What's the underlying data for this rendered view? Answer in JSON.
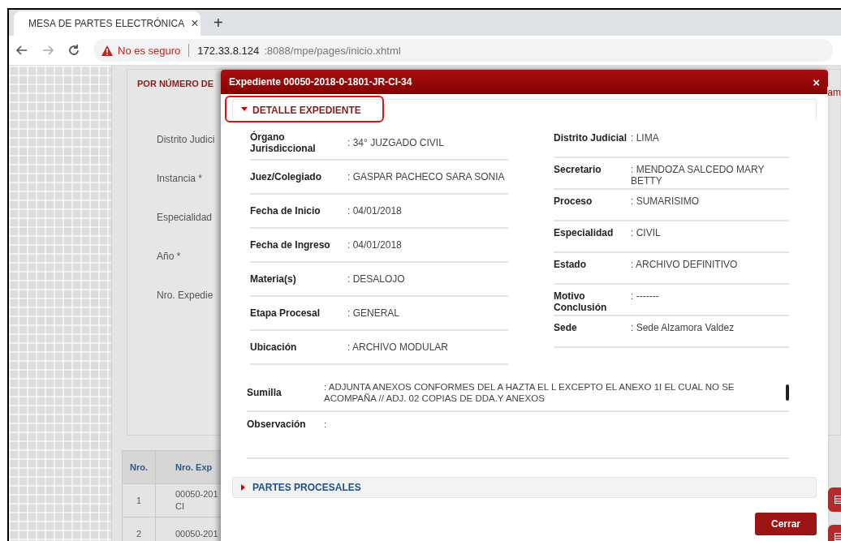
{
  "browser": {
    "tab_title": "MESA DE PARTES ELECTRÓNICA",
    "tab_close": "×",
    "new_tab": "+",
    "warning": "No es seguro",
    "url_host": "172.33.8.124",
    "url_path": ":8088/mpe/pages/inicio.xhtml"
  },
  "page": {
    "tab_label": "POR NÚMERO DE",
    "side_text": "am",
    "form_labels": [
      "Distrito Judici",
      "Instancia *",
      "Especialidad",
      "Año *",
      "Nro. Expedie"
    ],
    "table": {
      "columns": [
        "Nro.",
        "Nro. Exp"
      ],
      "rows": [
        {
          "cells": [
            "1",
            "00050-201\nCI"
          ]
        },
        {
          "cells": [
            "2",
            "00050-201"
          ]
        }
      ]
    }
  },
  "modal": {
    "title": "Expediente 00050-2018-0-1801-JR-CI-34",
    "close": "×",
    "sections": [
      {
        "title": "DETALLE EXPEDIENTE",
        "expanded": true,
        "highlighted": true
      },
      {
        "title": "PARTES PROCESALES",
        "expanded": false,
        "highlighted": false
      }
    ],
    "left_fields": [
      {
        "label": "Órgano Jurisdiccional",
        "value": ": 34° JUZGADO CIVIL"
      },
      {
        "label": "Juez/Colegiado",
        "value": ": GASPAR PACHECO SARA SONIA"
      },
      {
        "label": "Fecha de Inicio",
        "value": ": 04/01/2018"
      },
      {
        "label": "Fecha de Ingreso",
        "value": ": 04/01/2018"
      },
      {
        "label": "Materia(s)",
        "value": ": DESALOJO"
      },
      {
        "label": "Etapa Procesal",
        "value": ": GENERAL"
      },
      {
        "label": "Ubicación",
        "value": ": ARCHIVO MODULAR"
      }
    ],
    "right_fields": [
      {
        "label": "Distrito Judicial",
        "value": ": LIMA"
      },
      {
        "label": "Secretario",
        "value": ": MENDOZA SALCEDO MARY BETTY"
      },
      {
        "label": "Proceso",
        "value": ": SUMARISIMO"
      },
      {
        "label": "Especialidad",
        "value": ": CIVIL"
      },
      {
        "label": "Estado",
        "value": ": ARCHIVO DEFINITIVO"
      },
      {
        "label": "Motivo Conclusión",
        "value": ": -------"
      },
      {
        "label": "Sede",
        "value": ": Sede Alzamora Valdez"
      }
    ],
    "wide_fields": [
      {
        "label": "Sumilla",
        "value": ": ADJUNTA ANEXOS CONFORMES DEL A HAZTA EL L EXCEPTO EL ANEXO 1I EL CUAL NO SE ACOMPAÑA // ADJ. 02 COPIAS DE DDA.Y ANEXOS",
        "scrollable": true
      },
      {
        "label": "Observación",
        "value": ":",
        "scrollable": false
      }
    ],
    "button": "Cerrar"
  }
}
